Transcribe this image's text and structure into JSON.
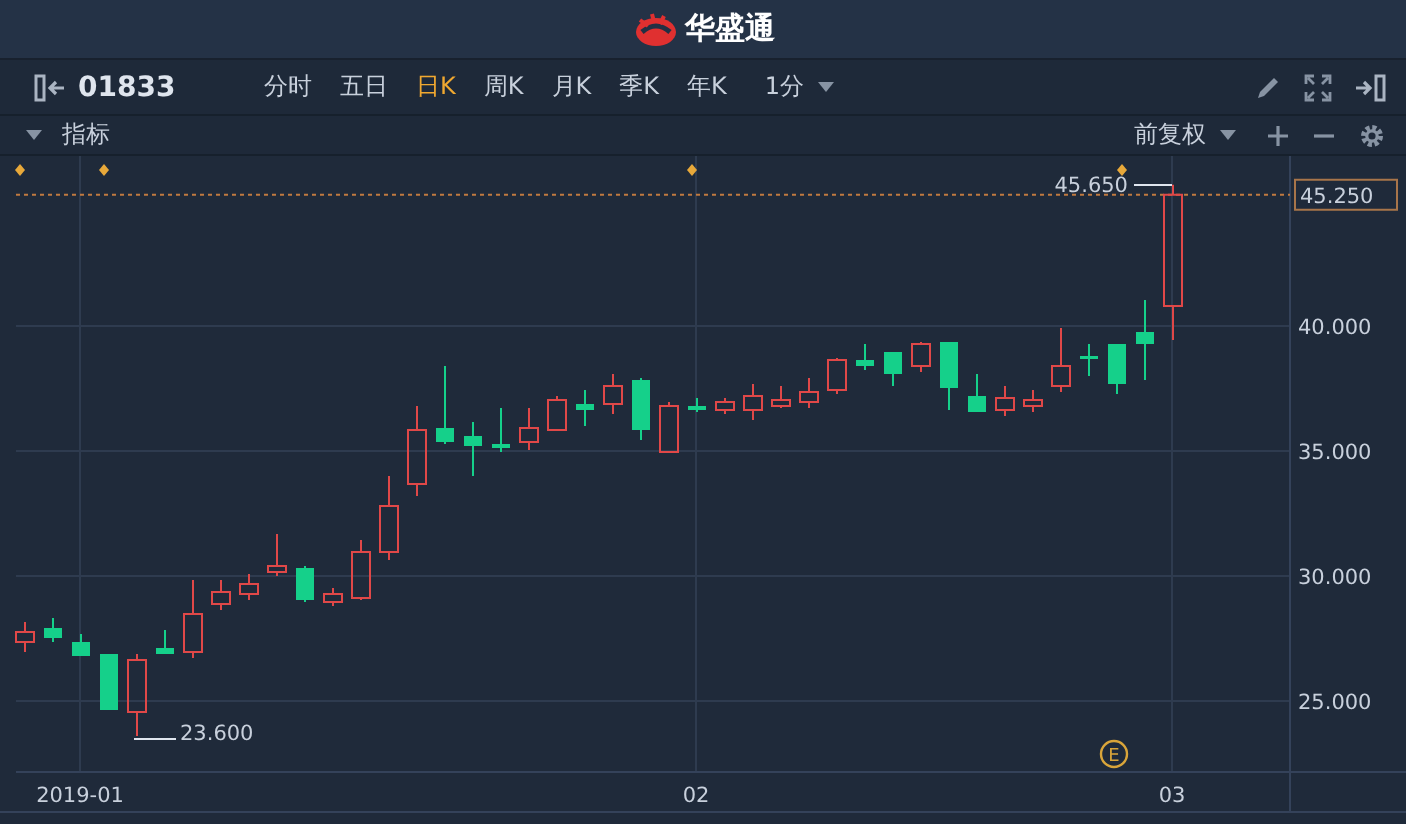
{
  "app": {
    "logo_text": "华盛通"
  },
  "toolbar": {
    "symbol": "01833",
    "interval": "1分",
    "periods": [
      {
        "label": "分时",
        "selected": false
      },
      {
        "label": "五日",
        "selected": false
      },
      {
        "label": "日K",
        "selected": true
      },
      {
        "label": "周K",
        "selected": false
      },
      {
        "label": "月K",
        "selected": false
      },
      {
        "label": "季K",
        "selected": false
      },
      {
        "label": "年K",
        "selected": false
      }
    ]
  },
  "indicator_bar": {
    "label": "指标",
    "adjustment": "前复权"
  },
  "chart": {
    "high_label": "45.650",
    "low_label": "23.600",
    "event_marker": "E",
    "chart_data": {
      "type": "candlestick",
      "categories": [
        null,
        null,
        "2019-01",
        null,
        null,
        null,
        null,
        null,
        null,
        null,
        null,
        null,
        null,
        null,
        null,
        null,
        null,
        null,
        null,
        null,
        null,
        null,
        null,
        null,
        "02",
        null,
        null,
        null,
        null,
        null,
        null,
        null,
        null,
        null,
        null,
        null,
        null,
        null,
        null,
        null,
        null,
        "03"
      ],
      "ohlc": [
        [
          27.36,
          28.16,
          26.96,
          27.76
        ],
        [
          27.92,
          28.32,
          27.36,
          27.52
        ],
        [
          27.36,
          27.68,
          26.8,
          26.8
        ],
        [
          26.88,
          26.88,
          24.64,
          24.64
        ],
        [
          24.56,
          26.88,
          23.6,
          26.64
        ],
        [
          27.12,
          27.84,
          26.88,
          26.88
        ],
        [
          26.96,
          29.84,
          26.72,
          28.48
        ],
        [
          28.88,
          29.84,
          28.64,
          29.36
        ],
        [
          29.28,
          30.08,
          29.04,
          29.68
        ],
        [
          30.16,
          31.68,
          30.0,
          30.4
        ],
        [
          30.32,
          30.4,
          28.96,
          29.04
        ],
        [
          28.96,
          29.52,
          28.8,
          29.28
        ],
        [
          29.12,
          31.44,
          29.04,
          30.96
        ],
        [
          30.96,
          34.0,
          30.64,
          32.8
        ],
        [
          33.68,
          36.8,
          33.2,
          35.84
        ],
        [
          35.92,
          38.4,
          35.28,
          35.36
        ],
        [
          35.6,
          36.16,
          34.0,
          35.2
        ],
        [
          35.28,
          36.72,
          34.96,
          35.12
        ],
        [
          35.36,
          36.72,
          35.04,
          35.92
        ],
        [
          35.84,
          37.2,
          35.84,
          37.04
        ],
        [
          36.88,
          37.44,
          36.0,
          36.64
        ],
        [
          36.88,
          38.08,
          36.48,
          37.6
        ],
        [
          37.84,
          37.92,
          35.44,
          35.84
        ],
        [
          34.96,
          36.96,
          34.96,
          36.8
        ],
        [
          36.8,
          37.12,
          36.56,
          36.64
        ],
        [
          36.64,
          37.12,
          36.48,
          36.96
        ],
        [
          36.64,
          37.68,
          36.24,
          37.2
        ],
        [
          36.8,
          37.6,
          36.72,
          37.04
        ],
        [
          36.96,
          37.92,
          36.72,
          37.36
        ],
        [
          37.44,
          38.72,
          37.28,
          38.64
        ],
        [
          38.64,
          39.28,
          38.24,
          38.4
        ],
        [
          38.96,
          38.96,
          37.6,
          38.08
        ],
        [
          38.4,
          39.36,
          38.16,
          39.28
        ],
        [
          39.36,
          39.36,
          36.64,
          37.52
        ],
        [
          37.2,
          38.08,
          36.56,
          36.56
        ],
        [
          36.64,
          37.6,
          36.4,
          37.12
        ],
        [
          36.8,
          37.44,
          36.56,
          37.04
        ],
        [
          37.6,
          39.92,
          37.36,
          38.4
        ],
        [
          38.8,
          39.28,
          38.0,
          38.72
        ],
        [
          39.28,
          39.28,
          37.28,
          37.68
        ],
        [
          39.76,
          41.04,
          37.84,
          39.28
        ],
        [
          40.8,
          45.65,
          39.44,
          45.25
        ]
      ],
      "ylim": [
        22.16,
        46.8
      ],
      "grid": true,
      "ref_lines": [
        {
          "axis": "y",
          "value": 45.25,
          "label": "45.250"
        }
      ],
      "yticks": [
        {
          "value": 40,
          "label": "40.000"
        },
        {
          "value": 35,
          "label": "35.000"
        },
        {
          "value": 30,
          "label": "30.000"
        },
        {
          "value": 25,
          "label": "25.000"
        }
      ]
    }
  }
}
